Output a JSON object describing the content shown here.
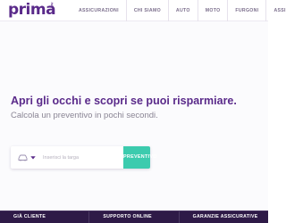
{
  "header": {
    "logo": {
      "text": "prima",
      "tld": ".it"
    },
    "nav": [
      {
        "label": "ASSICURAZIONI"
      },
      {
        "label": "CHI SIAMO"
      },
      {
        "label": "AUTO"
      },
      {
        "label": "MOTO"
      },
      {
        "label": "FURGONI"
      },
      {
        "label": "ASSIST"
      }
    ]
  },
  "hero": {
    "headline": "Apri gli occhi e scopri se puoi risparmiare.",
    "subheadline": "Calcola un preventivo in pochi secondi."
  },
  "search": {
    "vehicle_icon": "car-icon",
    "dropdown_icon": "chevron-down-icon",
    "plate_placeholder": "Inserisci la targa",
    "plate_value": "",
    "button_label": "PREVENTIVO"
  },
  "footer": {
    "columns": [
      {
        "label": "GIÀ CLIENTE"
      },
      {
        "label": "SUPPORTO ONLINE"
      },
      {
        "label": "GARANZIE ASSICURATIVE"
      }
    ]
  },
  "colors": {
    "brand_purple": "#5a2a8a",
    "accent_teal": "#3ccbae",
    "footer_bg": "#2e1a47",
    "nav_text": "#7b6e8c",
    "subtitle_text": "#8a8594"
  }
}
